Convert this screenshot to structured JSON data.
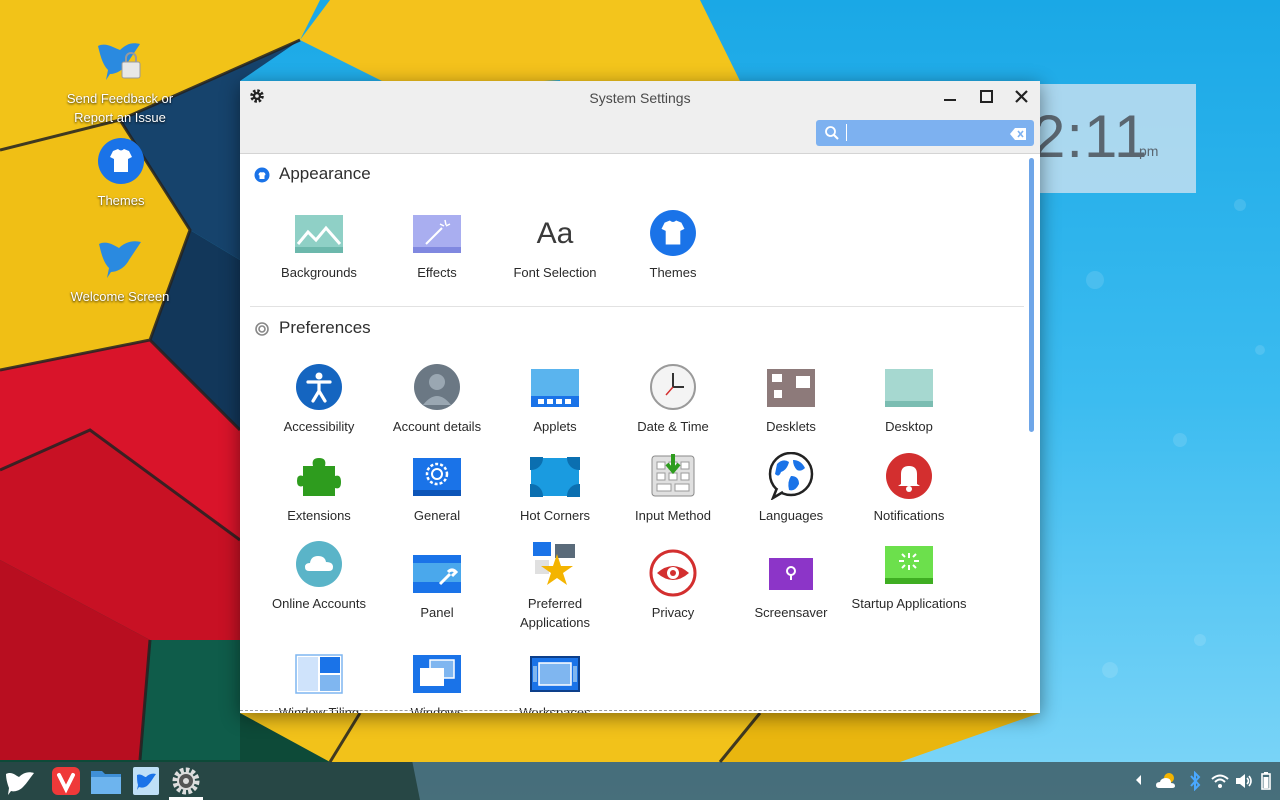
{
  "desktop": {
    "icons": [
      {
        "label": "Send Feedback or Report an Issue",
        "icon": "feedback-bird-lock-icon"
      },
      {
        "label": "Themes",
        "icon": "tshirt-icon"
      },
      {
        "label": "Welcome Screen",
        "icon": "bird-icon"
      }
    ],
    "clock": {
      "time": "2:11",
      "ampm": "pm"
    }
  },
  "window": {
    "title": "System Settings",
    "search": {
      "value": "",
      "placeholder": ""
    },
    "sections": [
      {
        "title": "Appearance",
        "icon": "appearance-icon",
        "items": [
          {
            "label": "Backgrounds",
            "icon": "backgrounds-icon"
          },
          {
            "label": "Effects",
            "icon": "effects-icon"
          },
          {
            "label": "Font Selection",
            "icon": "font-icon",
            "glyph": "Aa"
          },
          {
            "label": "Themes",
            "icon": "tshirt-icon"
          }
        ]
      },
      {
        "title": "Preferences",
        "icon": "preferences-icon",
        "items": [
          {
            "label": "Accessibility",
            "icon": "accessibility-icon"
          },
          {
            "label": "Account details",
            "icon": "account-icon"
          },
          {
            "label": "Applets",
            "icon": "applets-icon"
          },
          {
            "label": "Date & Time",
            "icon": "clock-icon"
          },
          {
            "label": "Desklets",
            "icon": "desklets-icon"
          },
          {
            "label": "Desktop",
            "icon": "desktop-icon"
          },
          {
            "label": "Extensions",
            "icon": "puzzle-icon"
          },
          {
            "label": "General",
            "icon": "general-gear-icon"
          },
          {
            "label": "Hot Corners",
            "icon": "hot-corners-icon"
          },
          {
            "label": "Input Method",
            "icon": "keyboard-icon"
          },
          {
            "label": "Languages",
            "icon": "globe-icon"
          },
          {
            "label": "Notifications",
            "icon": "bell-icon"
          },
          {
            "label": "Online Accounts",
            "icon": "cloud-icon"
          },
          {
            "label": "Panel",
            "icon": "panel-icon"
          },
          {
            "label": "Preferred Applications",
            "icon": "star-icon"
          },
          {
            "label": "Privacy",
            "icon": "eye-icon"
          },
          {
            "label": "Screensaver",
            "icon": "lock-icon"
          },
          {
            "label": "Startup Applications",
            "icon": "startup-icon"
          },
          {
            "label": "Window Tiling",
            "icon": "tiling-icon"
          },
          {
            "label": "Windows",
            "icon": "windows-icon"
          },
          {
            "label": "Workspaces",
            "icon": "workspaces-icon"
          }
        ]
      }
    ]
  },
  "taskbar": {
    "apps": [
      "menu-bird-icon",
      "vivaldi-icon",
      "files-icon",
      "feedback-icon",
      "settings-gear-icon"
    ],
    "tray": [
      "chevron-left-icon",
      "weather-icon",
      "bluetooth-icon",
      "wifi-icon",
      "volume-icon",
      "battery-icon"
    ]
  },
  "colors": {
    "accent": "#1a73e8",
    "search_bg": "#7db1f0",
    "taskbar": "#324649"
  }
}
